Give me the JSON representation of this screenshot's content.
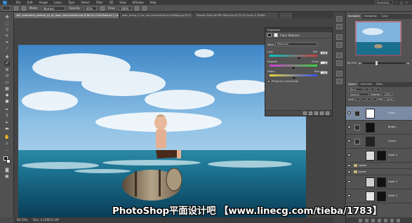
{
  "app": {
    "logo": "Ps",
    "menu": [
      "File",
      "Edit",
      "Image",
      "Layer",
      "Type",
      "Select",
      "Filter",
      "3D",
      "View",
      "Window",
      "Help"
    ],
    "workspace": "Essentials"
  },
  "options_bar": {
    "mode_label": "Mode:",
    "mode_value": "Normal",
    "opacity_label": "Opacity:",
    "opacity_value": "42%",
    "flow_label": "Flow:",
    "flow_value": "100%"
  },
  "tabs": [
    "480_underwater_partition_01_by_fopm_stock-d4e9e0.psd @ 66.5% (Color Balance 1, Layer Mask/8) *",
    "pobc_sitting_in_the_rain_thornwithstock-d1498bg.jpg @ 33...",
    "Monster Stock 89 PNG Stock.png @ 33.3% (Layer 0, RGB/8...",
    "..."
  ],
  "toolbar": {
    "tools": [
      "move-tool",
      "marquee-tool",
      "lasso-tool",
      "quick-select-tool",
      "crop-tool",
      "eyedropper-tool",
      "healing-tool",
      "brush-tool",
      "clone-tool",
      "history-brush-tool",
      "eraser-tool",
      "gradient-tool",
      "blur-tool",
      "dodge-tool",
      "pen-tool",
      "type-tool",
      "path-select-tool",
      "shape-tool",
      "hand-tool",
      "zoom-tool"
    ]
  },
  "properties": {
    "panel_title": "Properties",
    "adjustment": "Color Balance",
    "tone_label": "Tone:",
    "tone_value": "Midtones",
    "sliders": [
      {
        "left": "Cyan",
        "right": "Red",
        "value": "+18",
        "knob": 0.62
      },
      {
        "left": "Magenta",
        "right": "Green",
        "value": "0",
        "knob": 0.5
      },
      {
        "left": "Yellow",
        "right": "Blue",
        "value": "+2",
        "knob": 0.52
      }
    ],
    "preserve_luminosity": "Preserve Luminosity"
  },
  "navigator": {
    "tabs": [
      "Navigator",
      "Histogram",
      "Color"
    ],
    "zoom": "66.53%"
  },
  "layers": {
    "tabs": [
      "Layers",
      "Channels",
      "Paths"
    ],
    "kind_label": "Kind",
    "blend_mode": "Normal",
    "opacity_label": "Opacity:",
    "opacity_value": "100%",
    "lock_label": "Lock:",
    "fill_label": "Fill:",
    "fill_value": "100%",
    "items": [
      {
        "name": "Color ...",
        "type": "adjustment",
        "selected": true
      },
      {
        "name": "Bright...",
        "type": "adjustment",
        "selected": false
      },
      {
        "name": "Curve...",
        "type": "adjustment",
        "selected": false
      },
      {
        "name": "Layer 1",
        "type": "pixel",
        "selected": false
      },
      {
        "name": "splash",
        "type": "group",
        "selected": false
      },
      {
        "name": "barrel",
        "type": "group",
        "selected": false
      },
      {
        "name": "Layer 1",
        "type": "pixel",
        "selected": false
      },
      {
        "name": "Layer 1",
        "type": "pixel",
        "selected": false
      }
    ]
  },
  "status": {
    "zoom": "66.53%",
    "doc": "Doc: 4.12M/31.1M"
  },
  "watermark": "PhotoShop平面设计吧 【www.linecg.com/tieba/1783】",
  "colors": {
    "panel": "#535353",
    "dark": "#3a3a3a",
    "accent": "#7a8ba3"
  }
}
